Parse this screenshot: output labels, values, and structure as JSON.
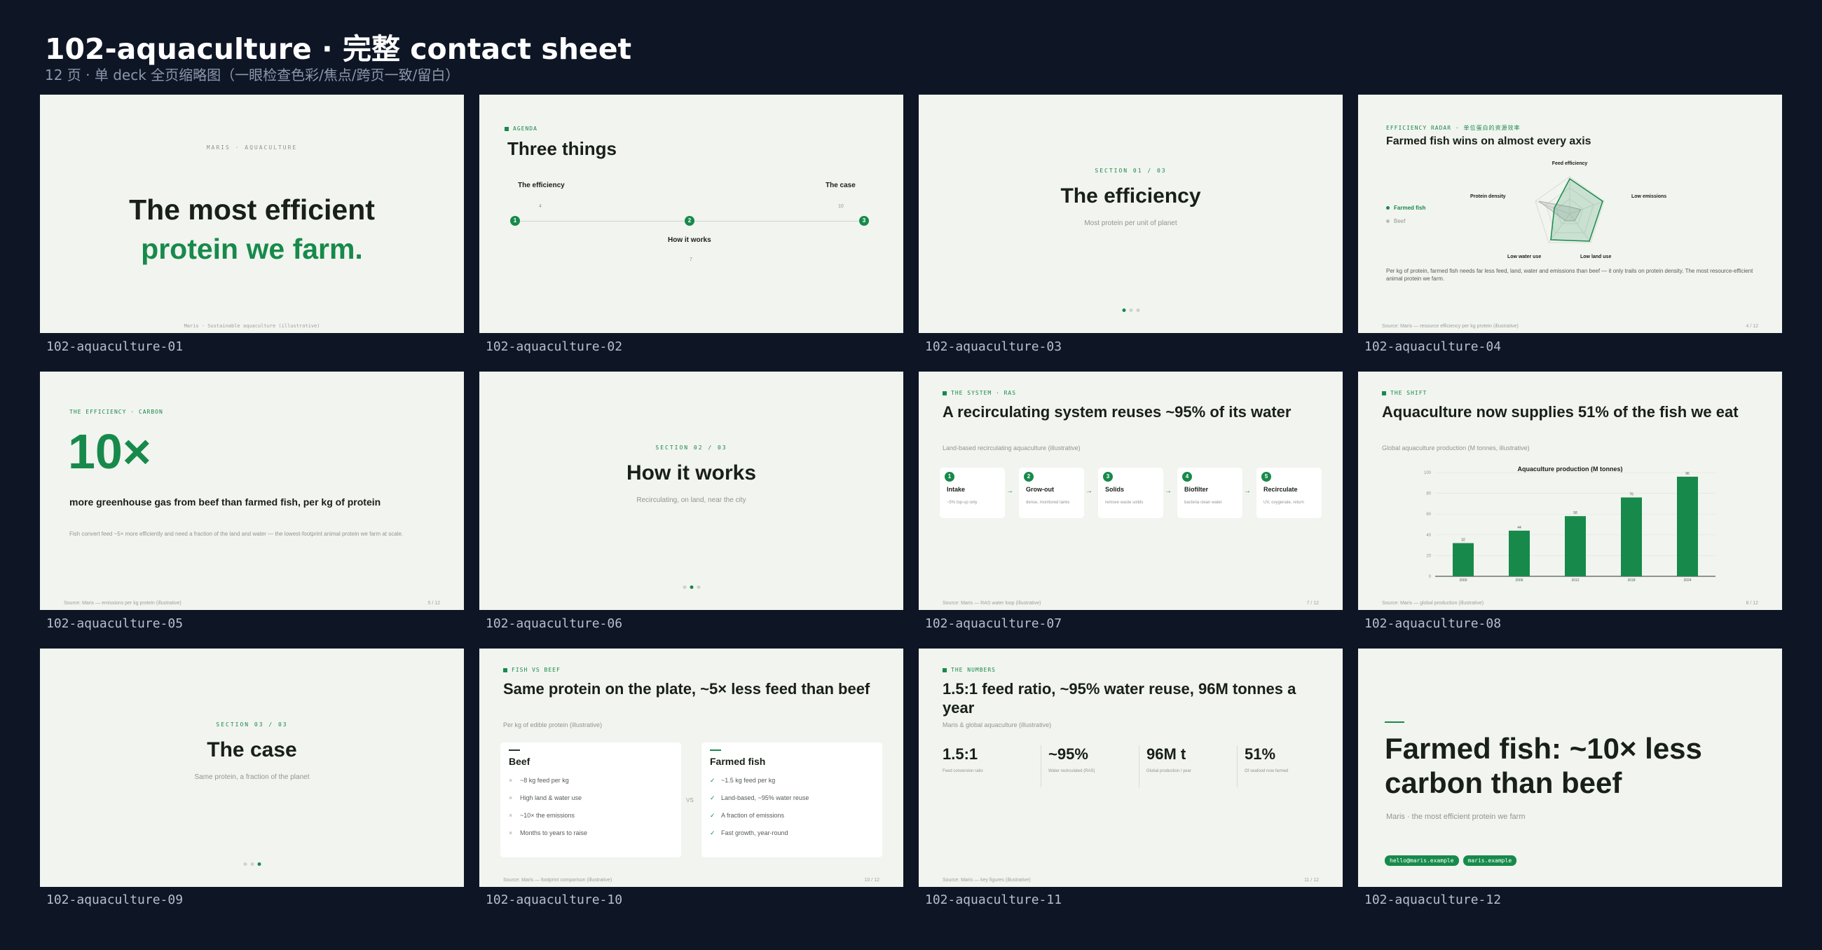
{
  "header": {
    "title": "102-aquaculture · 完整 contact sheet",
    "subtitle": "12 页 · 单 deck 全页缩略图（一眼检查色彩/焦点/跨页一致/留白）"
  },
  "captions": [
    "102-aquaculture-01",
    "102-aquaculture-02",
    "102-aquaculture-03",
    "102-aquaculture-04",
    "102-aquaculture-05",
    "102-aquaculture-06",
    "102-aquaculture-07",
    "102-aquaculture-08",
    "102-aquaculture-09",
    "102-aquaculture-10",
    "102-aquaculture-11",
    "102-aquaculture-12"
  ],
  "s1": {
    "kicker": "MARIS · AQUACULTURE",
    "line1": "The most efficient",
    "line2": "protein we farm.",
    "foot": "Maris · Sustainable aquaculture (illustrative)"
  },
  "s2": {
    "kicker": "AGENDA",
    "title": "Three things",
    "items": [
      {
        "n": "1",
        "label": "The efficiency",
        "page": "4"
      },
      {
        "n": "2",
        "label": "How it works",
        "page": "7"
      },
      {
        "n": "3",
        "label": "The case",
        "page": "10"
      }
    ]
  },
  "s3": {
    "kicker": "SECTION 01 / 03",
    "title": "The efficiency",
    "sub": "Most protein per unit of planet"
  },
  "s4": {
    "kicker": "EFFICIENCY RADAR · 单位蛋白的资源效率",
    "title": "Farmed fish wins on almost every axis",
    "legend": [
      "Farmed fish",
      "Beef"
    ],
    "axes": [
      "Feed efficiency",
      "Low emissions",
      "Low land use",
      "Low water use",
      "Protein density"
    ],
    "body": "Per kg of protein, farmed fish needs far less feed, land, water and emissions than beef — it only trails on protein density. The most resource-efficient animal protein we farm.",
    "foot": "Source: Maris — resource efficiency per kg protein (illustrative)",
    "page": "4 / 12"
  },
  "s5": {
    "kicker": "THE EFFICIENCY · CARBON",
    "big": "10×",
    "headline": "more greenhouse gas from beef than farmed fish, per kg of protein",
    "body": "Fish convert feed ~5× more efficiently and need a fraction of the land and water — the lowest-footprint animal protein we farm at scale.",
    "foot": "Source: Maris — emissions per kg protein (illustrative)",
    "page": "5 / 12"
  },
  "s6": {
    "kicker": "SECTION 02 / 03",
    "title": "How it works",
    "sub": "Recirculating, on land, near the city"
  },
  "s7": {
    "kicker": "THE SYSTEM · RAS",
    "title": "A recirculating system reuses ~95% of its water",
    "sub": "Land-based recirculating aquaculture (illustrative)",
    "steps": [
      {
        "n": "1",
        "label": "Intake",
        "desc": "~5% top-up only"
      },
      {
        "n": "2",
        "label": "Grow-out",
        "desc": "dense, monitored tanks"
      },
      {
        "n": "3",
        "label": "Solids",
        "desc": "remove waste solids"
      },
      {
        "n": "4",
        "label": "Biofilter",
        "desc": "bacteria clean water"
      },
      {
        "n": "5",
        "label": "Recirculate",
        "desc": "UV, oxygenate, return"
      }
    ],
    "foot": "Source: Maris — RAS water loop (illustrative)",
    "page": "7 / 12"
  },
  "s8": {
    "kicker": "THE SHIFT",
    "title": "Aquaculture now supplies 51% of the fish we eat",
    "sub": "Global aquaculture production (M tonnes, illustrative)",
    "foot": "Source: Maris — global production (illustrative)",
    "page": "8 / 12"
  },
  "chart_data": {
    "type": "bar",
    "title": "Aquaculture production (M tonnes)",
    "categories": [
      "2000",
      "2006",
      "2012",
      "2018",
      "2024"
    ],
    "values": [
      32,
      44,
      58,
      76,
      96
    ],
    "ylim": [
      0,
      100
    ],
    "yticks": [
      "0",
      "20",
      "40",
      "60",
      "80",
      "100"
    ]
  },
  "s9": {
    "kicker": "SECTION 03 / 03",
    "title": "The case",
    "sub": "Same protein, a fraction of the planet"
  },
  "s10": {
    "kicker": "FISH vs BEEF",
    "title": "Same protein on the plate, ~5× less feed than beef",
    "sub": "Per kg of edible protein (illustrative)",
    "vs": "VS",
    "beef": {
      "title": "Beef",
      "items": [
        "~8 kg feed per kg",
        "High land & water use",
        "~10× the emissions",
        "Months to years to raise"
      ]
    },
    "fish": {
      "title": "Farmed fish",
      "items": [
        "~1.5 kg feed per kg",
        "Land-based, ~95% water reuse",
        "A fraction of emissions",
        "Fast growth, year-round"
      ]
    },
    "foot": "Source: Maris — footprint comparison (illustrative)",
    "page": "10 / 12"
  },
  "s11": {
    "kicker": "THE NUMBERS",
    "title": "1.5:1 feed ratio, ~95% water reuse, 96M tonnes a year",
    "sub": "Maris & global aquaculture (illustrative)",
    "stats": [
      {
        "value": "1.5:1",
        "label": "Feed conversion ratio"
      },
      {
        "value": "~95%",
        "label": "Water recirculated (RAS)"
      },
      {
        "value": "96M t",
        "label": "Global production / year"
      },
      {
        "value": "51%",
        "label": "Of seafood now farmed"
      }
    ],
    "foot": "Source: Maris — key figures (illustrative)",
    "page": "11 / 12"
  },
  "s12": {
    "title": "Farmed fish: ~10× less carbon than beef",
    "sub": "Maris · the most efficient protein we farm",
    "pills": [
      "hello@maris.example",
      "maris.example"
    ]
  }
}
